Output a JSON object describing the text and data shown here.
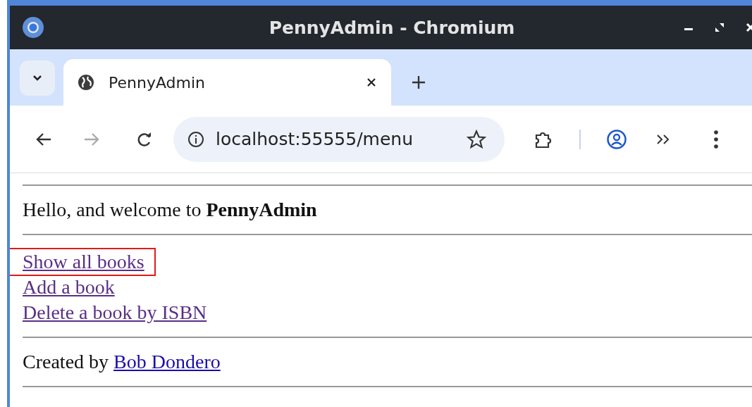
{
  "window": {
    "title": "PennyAdmin - Chromium"
  },
  "tabs": [
    {
      "title": "PennyAdmin",
      "selected": true
    }
  ],
  "address_bar": {
    "url": "localhost:55555/menu"
  },
  "page": {
    "greeting": "Hello, and welcome to **PennyAdmin**",
    "links": [
      {
        "label": "Show all books",
        "visited": true,
        "highlighted": true
      },
      {
        "label": "Add a book",
        "visited": true,
        "highlighted": false
      },
      {
        "label": "Delete a book by ISBN",
        "visited": true,
        "highlighted": false
      }
    ],
    "footer": {
      "text": "Created by",
      "link": {
        "label": "Bob Dondero",
        "visited": false,
        "highlighted": false
      }
    }
  }
}
